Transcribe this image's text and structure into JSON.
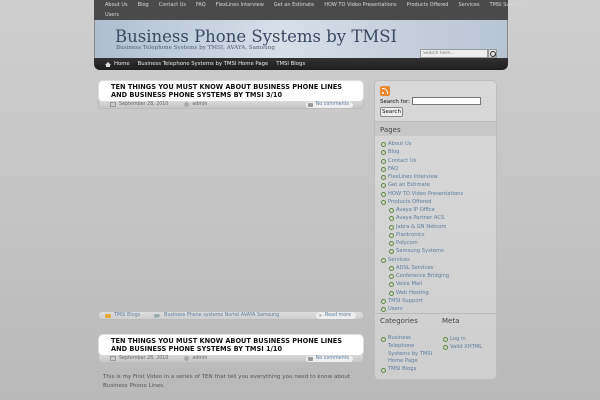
{
  "top_nav": {
    "row1": [
      "About Us",
      "Blog",
      "Contact Us",
      "FAQ",
      "FlexLines Interview",
      "Get an Estimate",
      "HOW TO Video Presentations",
      "Products Offered",
      "Services",
      "TMSI Support"
    ],
    "row2": [
      "Users"
    ]
  },
  "header": {
    "title": "Business Phone Systems by TMSI",
    "description": "Business Telephone Systems by TMSI, AVAYA, Samsung",
    "search_placeholder": "Search here..."
  },
  "sub_nav": [
    "Home",
    "Business Telephone Systems by TMSI Home Page",
    "TMSI Blogs"
  ],
  "posts": [
    {
      "title": "TEN THINGS YOU MUST KNOW ABOUT BUSINESS PHONE LINES AND BUSINESS PHONE SYSTEMS BY TMSI 3/10",
      "date": "September 28, 2010",
      "author": "admin",
      "comments": "No comments",
      "category": "TMSI Blogs",
      "tags": "Business Phone systems Nortel AVAYA Samsung",
      "read_more": "Read more"
    },
    {
      "title": "TEN THINGS YOU MUST KNOW ABOUT BUSINESS PHONE LINES AND BUSINESS PHONE SYSTEMS BY TMSI 1/10",
      "date": "September 28, 2010",
      "author": "admin",
      "comments": "No comments",
      "excerpt": "This is my First Video in a series of TEN that tell you everything you need to know about Business Phone Lines."
    }
  ],
  "sidebar": {
    "search_label": "Search for:",
    "search_button": "Search",
    "pages_heading": "Pages",
    "pages": [
      {
        "label": "About Us",
        "sub": false
      },
      {
        "label": "Blog",
        "sub": false
      },
      {
        "label": "Contact Us",
        "sub": false
      },
      {
        "label": "FAQ",
        "sub": false
      },
      {
        "label": "FlexLines Interview",
        "sub": false
      },
      {
        "label": "Get an Estimate",
        "sub": false
      },
      {
        "label": "HOW TO Video Presentations",
        "sub": false
      },
      {
        "label": "Products Offered",
        "sub": false
      },
      {
        "label": "Avaya IP Office",
        "sub": true
      },
      {
        "label": "Avaya Partner ACS",
        "sub": true
      },
      {
        "label": "Jabra & GN Netcom",
        "sub": true
      },
      {
        "label": "Plantronics",
        "sub": true
      },
      {
        "label": "Polycom",
        "sub": true
      },
      {
        "label": "Samsung Systems",
        "sub": true
      },
      {
        "label": "Services",
        "sub": false
      },
      {
        "label": "ADSL Services",
        "sub": true
      },
      {
        "label": "Conference Bridging",
        "sub": true
      },
      {
        "label": "Voice Mail",
        "sub": true
      },
      {
        "label": "Web Hosting",
        "sub": true
      },
      {
        "label": "TMSI Support",
        "sub": false
      },
      {
        "label": "Users",
        "sub": false
      }
    ],
    "categories_heading": "Categories",
    "categories": [
      "Business Telephone Systems by TMSI Home Page",
      "TMSI Blogs"
    ],
    "meta_heading": "Meta",
    "meta": [
      "Log in",
      "Valid XHTML"
    ]
  }
}
